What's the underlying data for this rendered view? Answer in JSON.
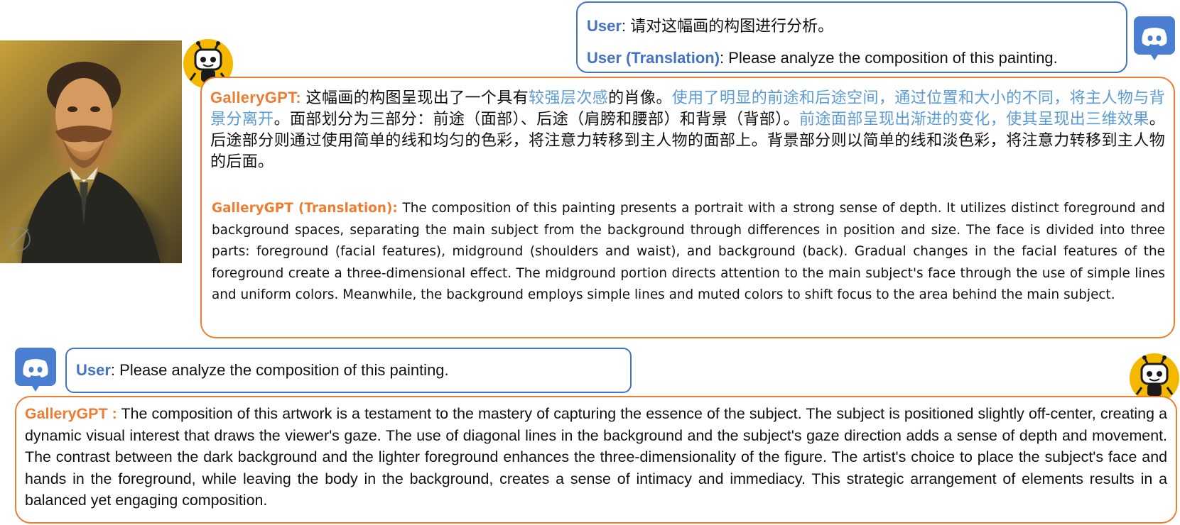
{
  "colors": {
    "user_blue": "#4472c4",
    "bot_orange": "#ed7d31",
    "highlight_blue": "#5b9bd5",
    "discord_blue": "#4a7ed0",
    "robot_yellow": "#f5b800"
  },
  "icons": {
    "discord": "discord-logo-icon",
    "robot": "robot-avatar-icon"
  },
  "top_user": {
    "speaker": "User",
    "text": ": 请对这幅画的构图进行分析。",
    "translation_speaker": "User (Translation)",
    "translation_text": ": Please analyze the composition of this painting."
  },
  "top_bot": {
    "speaker": "GalleryGPT:",
    "zh_1": " 这幅画的构图呈现出了一个具有",
    "zh_2_hl": "较强层次感",
    "zh_3": "的肖像。",
    "zh_4_hl": "使用了明显的前途和后途空间，通过位置和大小的不同，将主人物与背景分离开",
    "zh_5": "。面部划分为三部分：前途（面部）、后途（肩膀和腰部）和背景（背部）。",
    "zh_6_hl": "前途面部呈现出渐进的变化，使其呈现出三维效果",
    "zh_7": "。后途部分则通过使用简单的线和均匀的色彩，将注意力转移到主人物的面部上。背景部分则以简单的线和淡色彩，将注意力转移到主人物的后面。",
    "translation_speaker": "GalleryGPT (Translation):",
    "translation_text": " The composition of this painting presents a portrait with a strong sense of depth. It utilizes distinct foreground and background spaces, separating the main subject from the background through differences in position and size. The face is divided into three parts: foreground (facial features), midground (shoulders and waist), and background (back). Gradual changes in the facial features of the foreground create a three-dimensional effect. The midground portion directs attention to the main subject's face through the use of simple lines and uniform colors. Meanwhile, the background employs simple lines and muted colors to shift focus to the area behind the main subject."
  },
  "bottom_user": {
    "speaker": "User",
    "text": ": Please analyze the composition of this painting."
  },
  "bottom_bot": {
    "speaker": "GalleryGPT :",
    "text": " The composition of this artwork is a testament to the mastery of capturing the essence of the subject. The subject is positioned slightly off-center, creating a dynamic visual interest that draws the viewer's gaze. The use of diagonal lines in the background and the subject's gaze direction adds a sense of depth and movement. The contrast between the dark background and the lighter foreground enhances the three-dimensionality of the figure. The artist's choice to place the subject's face and hands in the foreground, while leaving the body in the background, creates a sense of intimacy and immediacy. This strategic arrangement of elements results in a balanced yet engaging composition."
  }
}
